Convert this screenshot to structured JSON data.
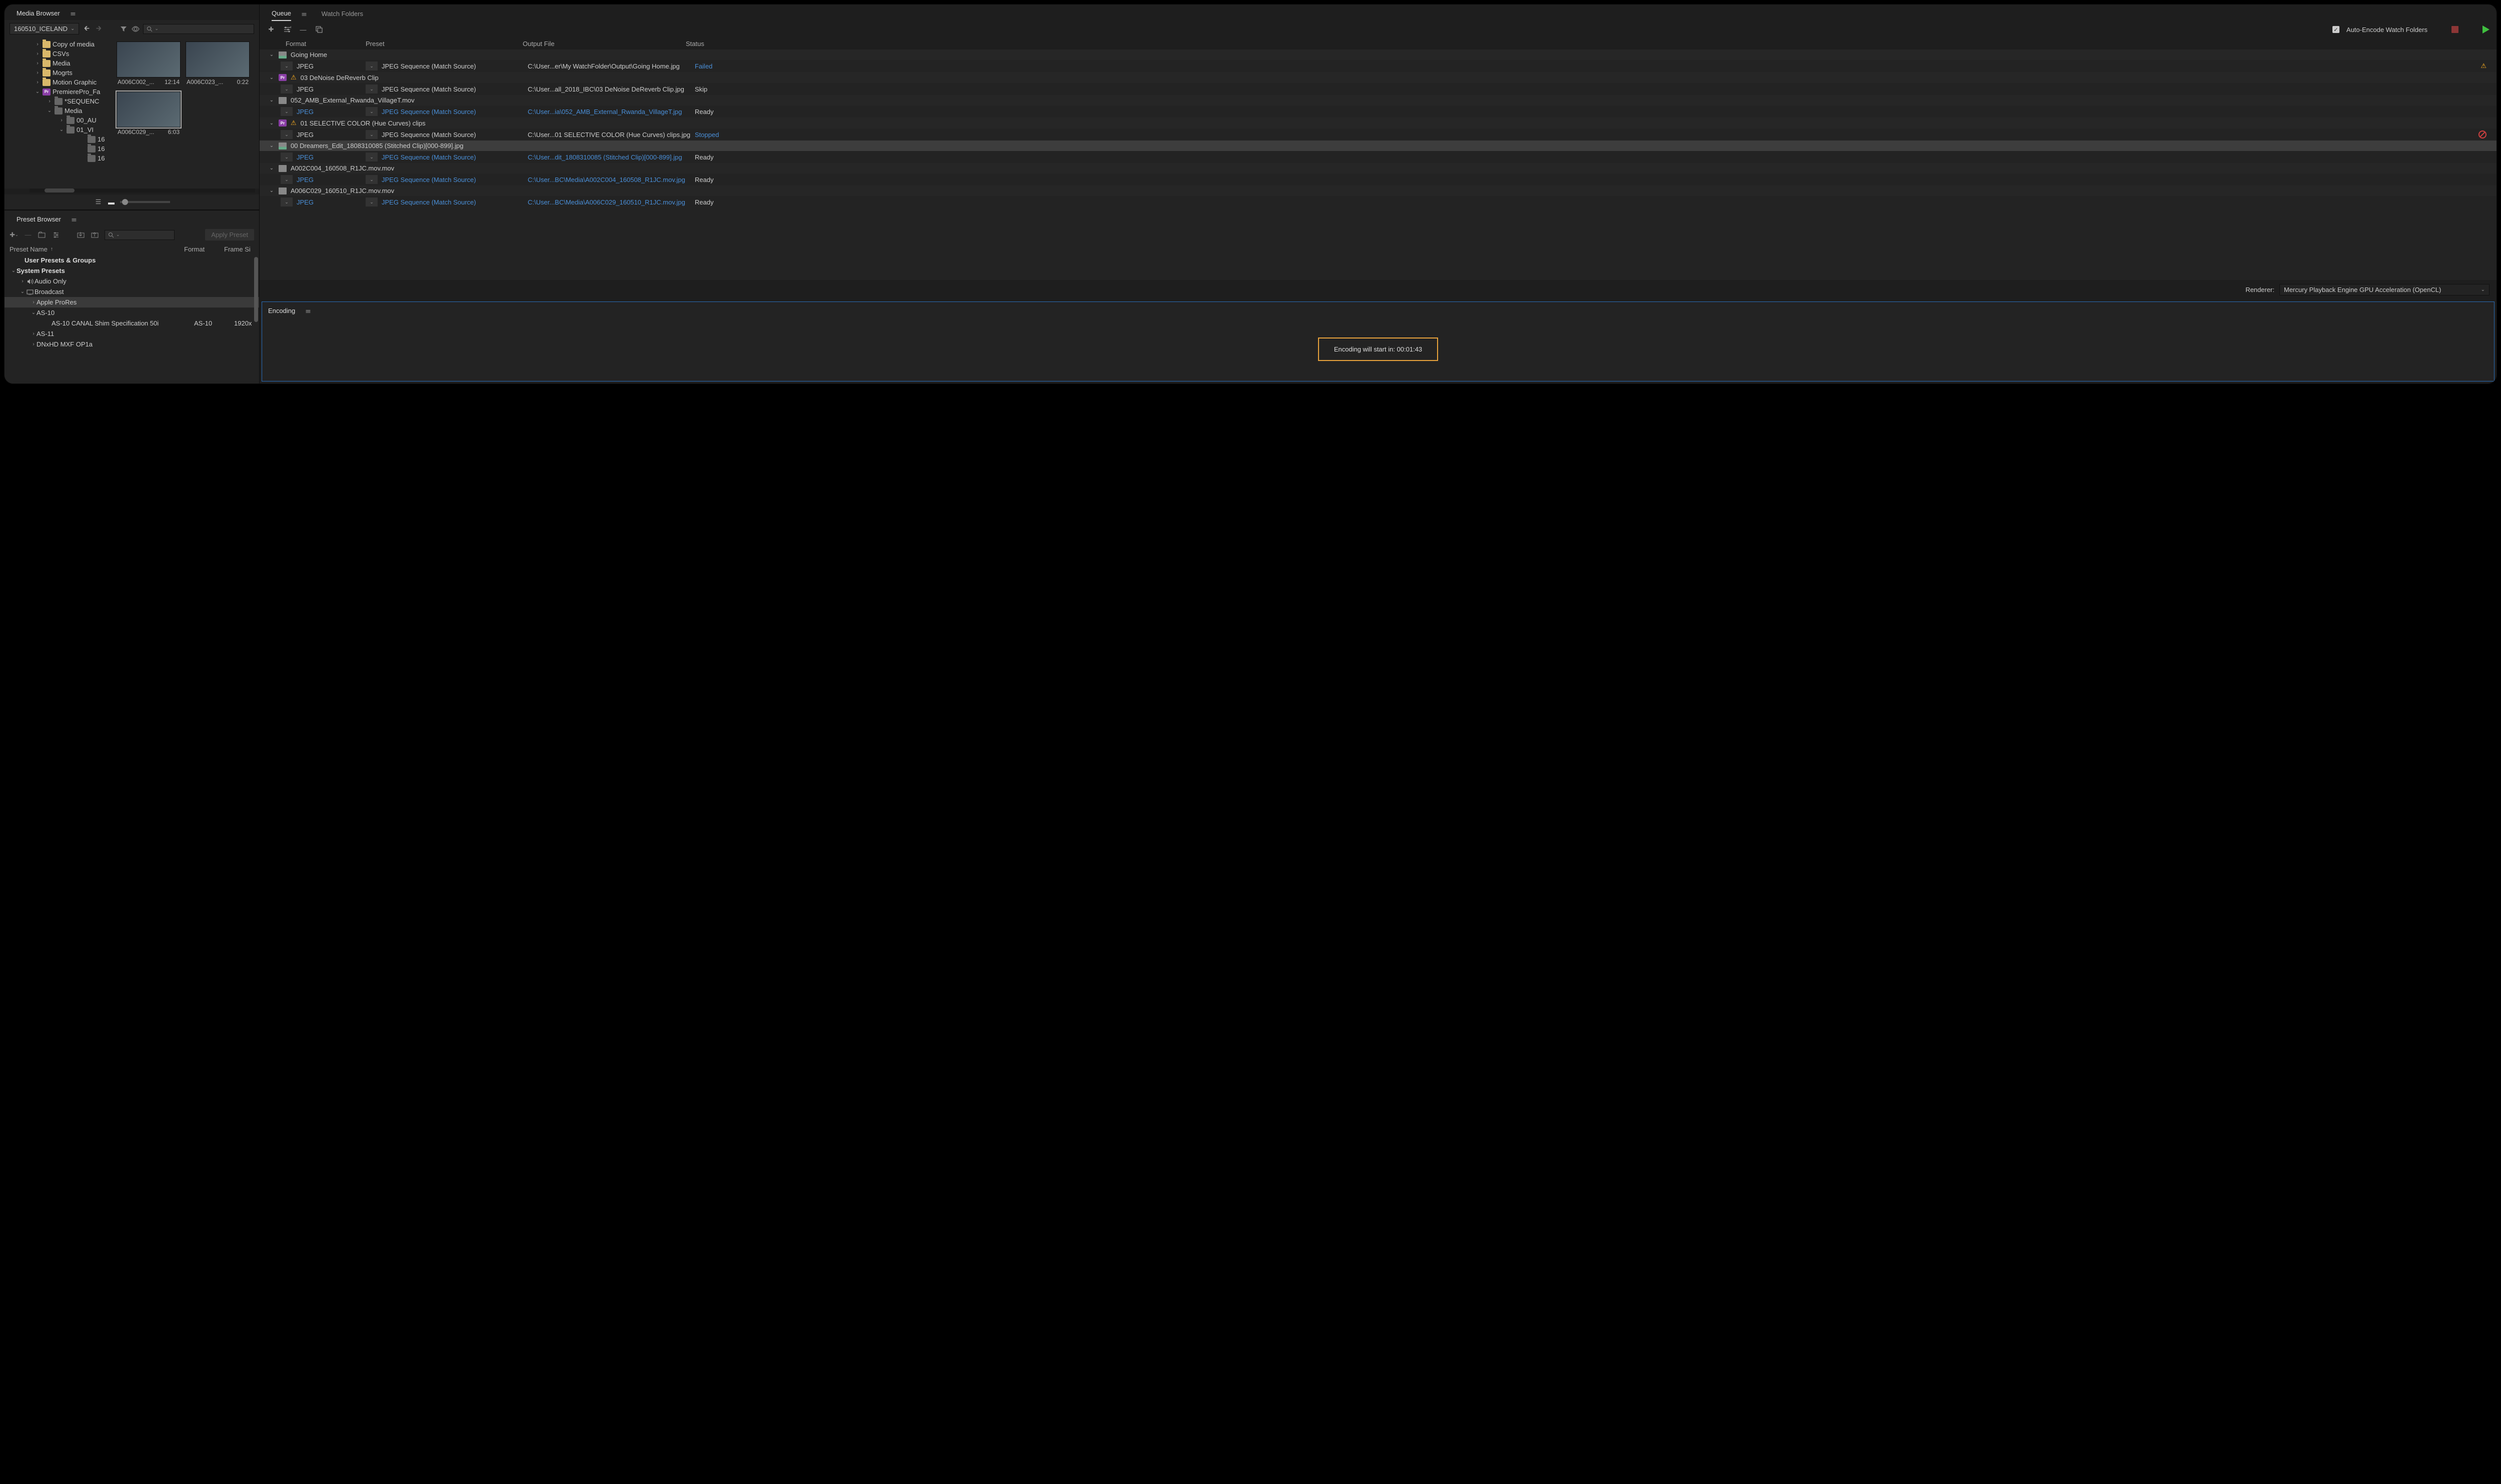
{
  "mediaBrowser": {
    "title": "Media Browser",
    "pathLabel": "160510_ICELAND",
    "tree": [
      {
        "ind": 60,
        "chev": "›",
        "icon": "fold",
        "label": "Copy of media"
      },
      {
        "ind": 60,
        "chev": "›",
        "icon": "fold",
        "label": "CSVs"
      },
      {
        "ind": 60,
        "chev": "›",
        "icon": "fold",
        "label": "Media"
      },
      {
        "ind": 60,
        "chev": "›",
        "icon": "fold",
        "label": "Mogrts"
      },
      {
        "ind": 60,
        "chev": "›",
        "icon": "fold",
        "label": "Motion Graphic"
      },
      {
        "ind": 60,
        "chev": "⌄",
        "icon": "pr",
        "label": "PremierePro_Fa"
      },
      {
        "ind": 84,
        "chev": "›",
        "icon": "foldg",
        "label": "*SEQUENC"
      },
      {
        "ind": 84,
        "chev": "⌄",
        "icon": "foldg",
        "label": "Media"
      },
      {
        "ind": 108,
        "chev": "›",
        "icon": "foldg",
        "label": "00_AU"
      },
      {
        "ind": 108,
        "chev": "⌄",
        "icon": "foldg",
        "label": "01_VI"
      },
      {
        "ind": 150,
        "chev": "",
        "icon": "foldg",
        "label": "16"
      },
      {
        "ind": 150,
        "chev": "",
        "icon": "foldg",
        "label": "16"
      },
      {
        "ind": 150,
        "chev": "",
        "icon": "foldg",
        "label": "16"
      }
    ],
    "thumbs": [
      {
        "name": "A006C002_...",
        "dur": "12:14"
      },
      {
        "name": "A006C023_...",
        "dur": "0:22"
      },
      {
        "name": "A006C029_...",
        "dur": "6:03",
        "sel": true
      }
    ]
  },
  "presetBrowser": {
    "title": "Preset Browser",
    "applyLabel": "Apply Preset",
    "headers": {
      "name": "Preset Name",
      "format": "Format",
      "fs": "Frame Si"
    },
    "rows": [
      {
        "ind": 28,
        "chev": "",
        "icon": "",
        "label": "User Presets & Groups",
        "bold": true
      },
      {
        "ind": 12,
        "chev": "⌄",
        "icon": "",
        "label": "System Presets",
        "bold": true
      },
      {
        "ind": 30,
        "chev": "›",
        "icon": "aud",
        "label": "Audio Only"
      },
      {
        "ind": 30,
        "chev": "⌄",
        "icon": "tv",
        "label": "Broadcast"
      },
      {
        "ind": 52,
        "chev": "›",
        "icon": "",
        "label": "Apple ProRes",
        "sel": true
      },
      {
        "ind": 52,
        "chev": "⌄",
        "icon": "",
        "label": "AS-10"
      },
      {
        "ind": 82,
        "chev": "",
        "icon": "",
        "label": "AS-10 CANAL Shim Specification 50i",
        "fmt": "AS-10",
        "fs": "1920x"
      },
      {
        "ind": 52,
        "chev": "›",
        "icon": "",
        "label": "AS-11"
      },
      {
        "ind": 52,
        "chev": "›",
        "icon": "",
        "label": "DNxHD MXF OP1a"
      }
    ]
  },
  "queue": {
    "tabQueue": "Queue",
    "tabWatch": "Watch Folders",
    "autoEncode": "Auto-Encode Watch Folders",
    "headers": {
      "fmt": "Format",
      "pre": "Preset",
      "out": "Output File",
      "st": "Status"
    },
    "rendererLabel": "Renderer:",
    "rendererValue": "Mercury Playback Engine GPU Acceleration (OpenCL)",
    "items": [
      {
        "type": "grp",
        "icon": "img",
        "warn": false,
        "pr": false,
        "label": "Going Home"
      },
      {
        "type": "row",
        "fmt": "JPEG",
        "pre": "JPEG Sequence (Match Source)",
        "out": "C:\\User...er\\My WatchFolder\\Output\\Going Home.jpg",
        "st": "Failed",
        "stcol": "#4a8fd8",
        "link": false,
        "warn": true
      },
      {
        "type": "grp",
        "icon": "",
        "warn": true,
        "pr": true,
        "label": "03 DeNoise DeReverb Clip"
      },
      {
        "type": "row",
        "fmt": "JPEG",
        "pre": "JPEG Sequence (Match Source)",
        "out": "C:\\User...all_2018_IBC\\03 DeNoise DeReverb Clip.jpg",
        "st": "Skip",
        "stcol": "#ccc",
        "link": false
      },
      {
        "type": "grp",
        "icon": "vid",
        "warn": false,
        "pr": false,
        "label": "052_AMB_External_Rwanda_VillageT.mov"
      },
      {
        "type": "row",
        "fmt": "JPEG",
        "pre": "JPEG Sequence (Match Source)",
        "out": "C:\\User...ia\\052_AMB_External_Rwanda_VillageT.jpg",
        "st": "Ready",
        "stcol": "#ccc",
        "link": true
      },
      {
        "type": "grp",
        "icon": "",
        "warn": true,
        "pr": true,
        "label": "01 SELECTIVE COLOR (Hue Curves) clips"
      },
      {
        "type": "row",
        "fmt": "JPEG",
        "pre": "JPEG Sequence (Match Source)",
        "out": "C:\\User...01 SELECTIVE COLOR (Hue Curves) clips.jpg",
        "st": "Stopped",
        "stcol": "#4a8fd8",
        "link": false,
        "no": true
      },
      {
        "type": "grp",
        "icon": "img",
        "warn": false,
        "pr": false,
        "label": "00 Dreamers_Edit_1808310085 (Stitched Clip)[000-899].jpg",
        "sel": true
      },
      {
        "type": "row",
        "fmt": "JPEG",
        "pre": "JPEG Sequence (Match Source)",
        "out": "C:\\User...dit_1808310085 (Stitched Clip)[000-899].jpg",
        "st": "Ready",
        "stcol": "#ccc",
        "link": true
      },
      {
        "type": "grp",
        "icon": "vid",
        "warn": false,
        "pr": false,
        "label": "A002C004_160508_R1JC.mov.mov"
      },
      {
        "type": "row",
        "fmt": "JPEG",
        "pre": "JPEG Sequence (Match Source)",
        "out": "C:\\User...BC\\Media\\A002C004_160508_R1JC.mov.jpg",
        "st": "Ready",
        "stcol": "#ccc",
        "link": true
      },
      {
        "type": "grp",
        "icon": "vid",
        "warn": false,
        "pr": false,
        "label": "A006C029_160510_R1JC.mov.mov"
      },
      {
        "type": "row",
        "fmt": "JPEG",
        "pre": "JPEG Sequence (Match Source)",
        "out": "C:\\User...BC\\Media\\A006C029_160510_R1JC.mov.jpg",
        "st": "Ready",
        "stcol": "#ccc",
        "link": true
      }
    ]
  },
  "encoding": {
    "title": "Encoding",
    "message": "Encoding will start in: 00:01:43"
  }
}
